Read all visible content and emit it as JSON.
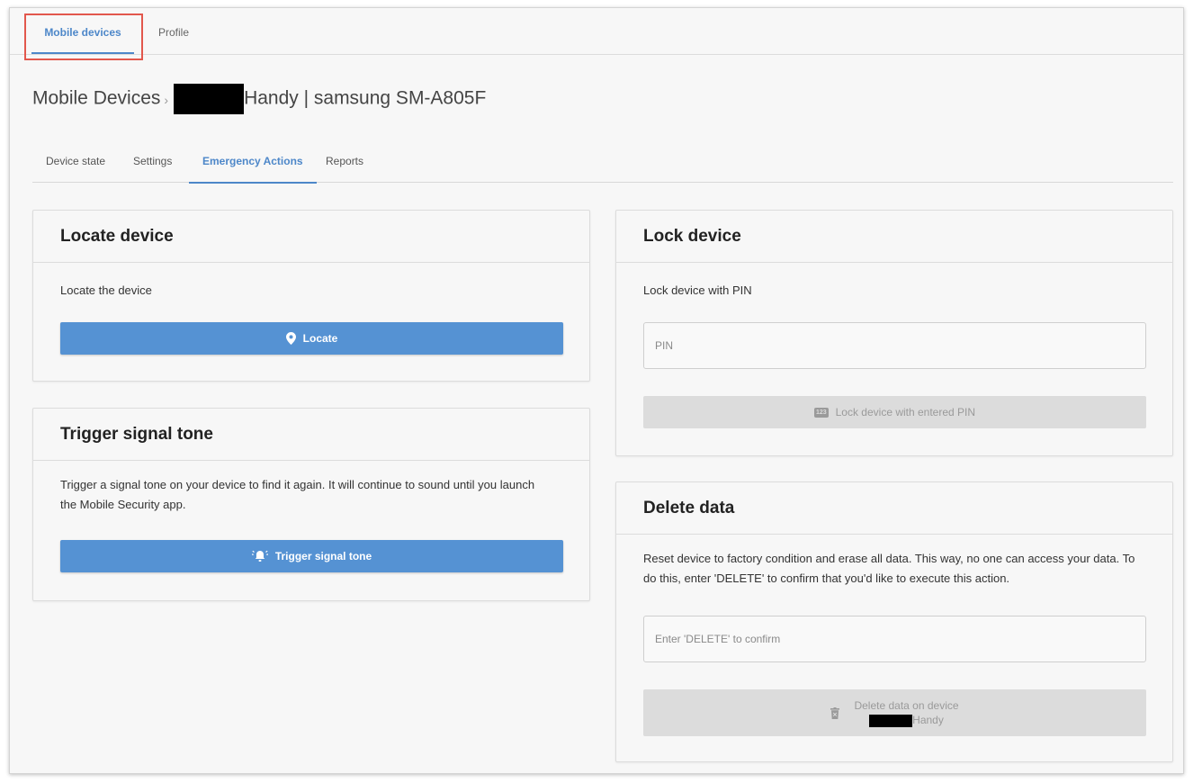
{
  "topnav": {
    "tabs": [
      {
        "label": "Mobile devices",
        "active": true
      },
      {
        "label": "Profile",
        "active": false
      }
    ]
  },
  "breadcrumb": {
    "root": "Mobile Devices",
    "separator": "›",
    "device_suffix": "Handy | samsung SM-A805F"
  },
  "subtabs": [
    {
      "label": "Device state"
    },
    {
      "label": "Settings"
    },
    {
      "label": "Emergency Actions",
      "active": true
    },
    {
      "label": "Reports"
    }
  ],
  "locate": {
    "title": "Locate device",
    "description": "Locate the device",
    "button_label": "Locate",
    "icon": "map-pin-icon"
  },
  "signal": {
    "title": "Trigger signal tone",
    "description": "Trigger a signal tone on your device to find it again. It will continue to sound until you launch the Mobile Security app.",
    "button_label": "Trigger signal tone",
    "icon": "alarm-bell-icon"
  },
  "lock": {
    "title": "Lock device",
    "description": "Lock device with PIN",
    "pin_placeholder": "PIN",
    "button_label": "Lock device with entered PIN",
    "icon_text": "123"
  },
  "delete": {
    "title": "Delete data",
    "description": "Reset device to factory condition and erase all data. This way, no one can access your data. To do this, enter 'DELETE' to confirm that you'd like to execute this action.",
    "confirm_placeholder": "Enter 'DELETE' to confirm",
    "button_line1": "Delete data on device",
    "button_line2_suffix": "Handy",
    "icon": "trash-icon"
  },
  "colors": {
    "accent": "#4d87c9",
    "button_primary": "#5592d3",
    "button_disabled": "#dcdcdc",
    "highlight": "#e2574c"
  }
}
